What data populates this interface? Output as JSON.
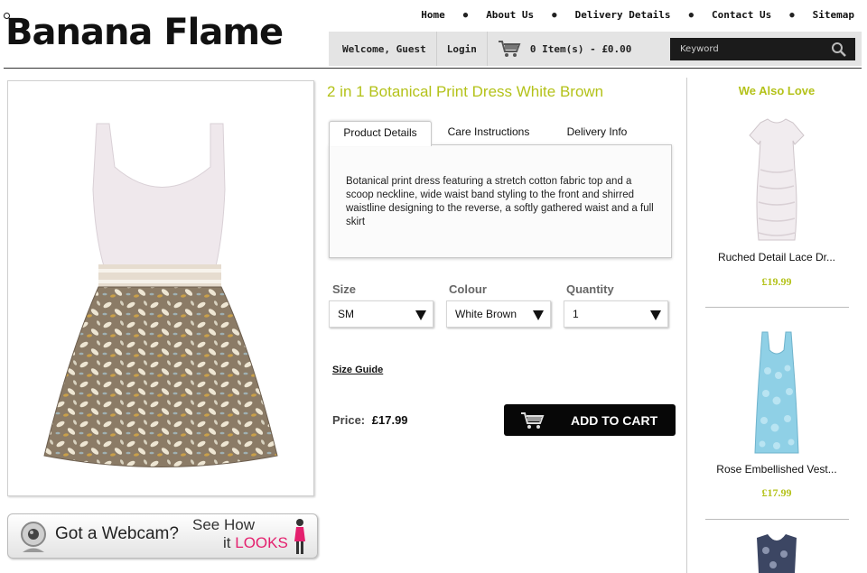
{
  "brand": {
    "logo_text": "Banana Flame"
  },
  "nav": {
    "items": [
      "Home",
      "About Us",
      "Delivery Details",
      "Contact Us",
      "Sitemap"
    ]
  },
  "user_bar": {
    "welcome": "Welcome, Guest",
    "login": "Login",
    "cart_summary": "0 Item(s) - £0.00",
    "search_placeholder": "Keyword"
  },
  "product": {
    "title": "2 in 1 Botanical Print Dress White Brown",
    "tabs": [
      "Product Details",
      "Care Instructions",
      "Delivery Info"
    ],
    "active_tab": "Product Details",
    "description": "Botanical print dress featuring a stretch cotton fabric top and a scoop neckline, wide waist band styling to the front and shirred waistline designing to the reverse, a softly gathered waist and a full skirt",
    "options": {
      "size": {
        "label": "Size",
        "value": "SM"
      },
      "colour": {
        "label": "Colour",
        "value": "White Brown"
      },
      "quantity": {
        "label": "Quantity",
        "value": "1"
      }
    },
    "size_guide": "Size Guide",
    "price_label": "Price:",
    "price": "£17.99",
    "add_to_cart": "ADD TO CART"
  },
  "webcam_banner": {
    "got": "Got a Webcam?",
    "see_how": "See How",
    "it": "it",
    "looks": "LOOKS"
  },
  "sidebar": {
    "title": "We Also Love",
    "items": [
      {
        "name": "Ruched Detail Lace Dr...",
        "price": "£19.99"
      },
      {
        "name": "Rose Embellished Vest...",
        "price": "£17.99"
      }
    ]
  },
  "colors": {
    "accent": "#b4c21a",
    "looks_pink": "#e4206e",
    "bar_grey": "#e4e4e4",
    "cart_button": "#070707"
  }
}
